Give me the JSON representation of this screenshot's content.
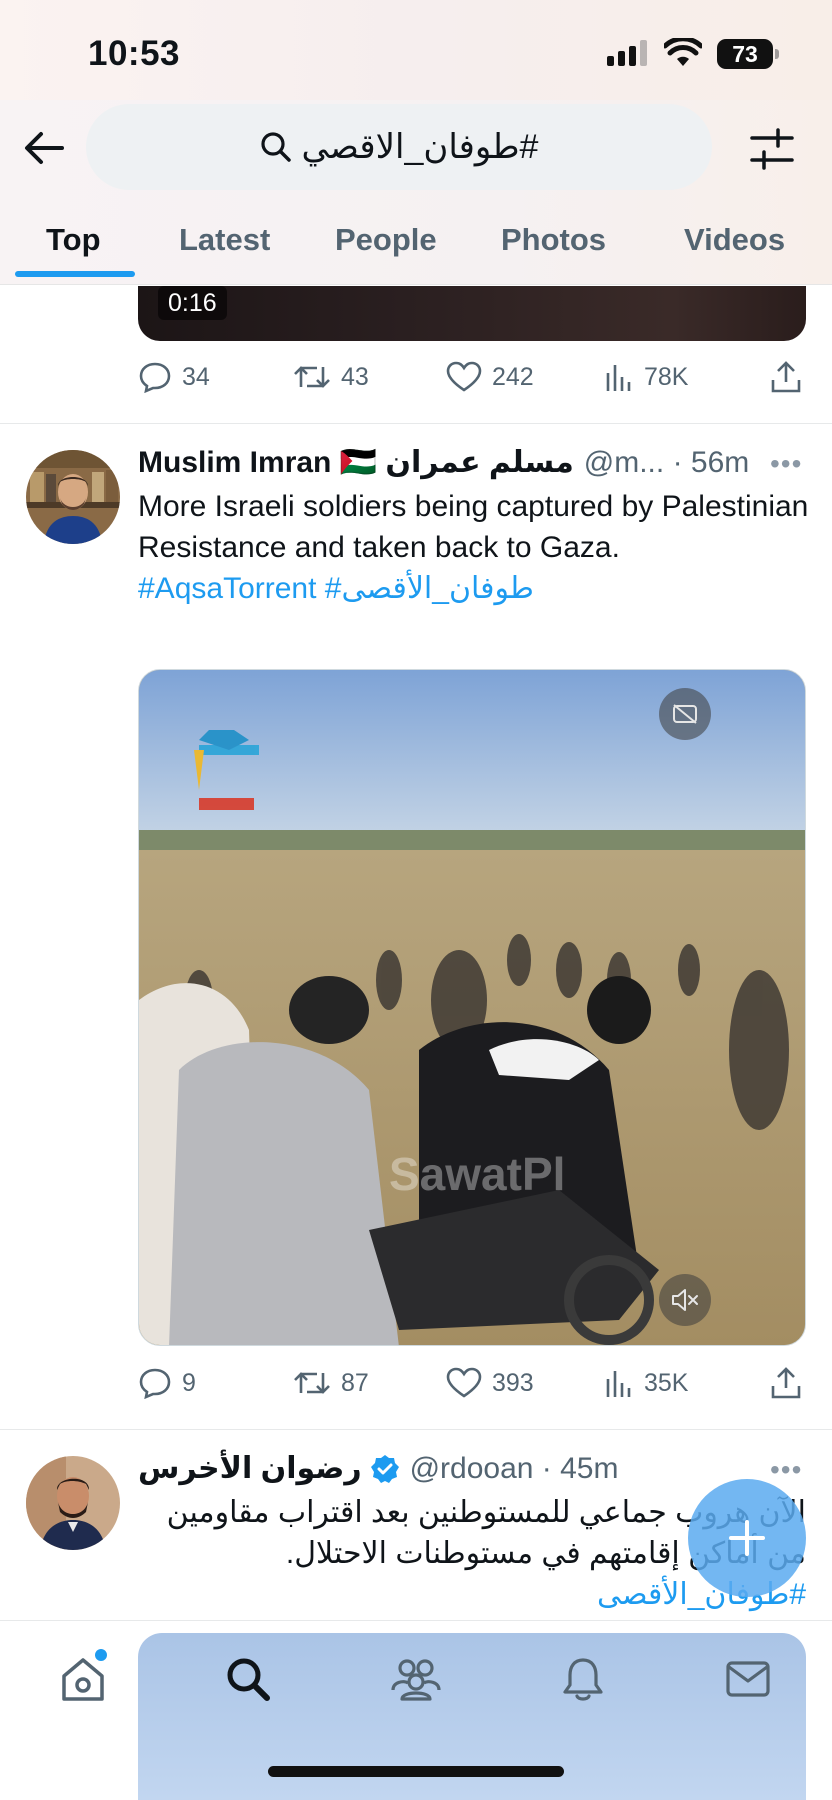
{
  "status_bar": {
    "time": "10:53",
    "battery": "73"
  },
  "search": {
    "query": "#طوفان_الاقصي"
  },
  "tabs": [
    {
      "label": "Top",
      "active": true
    },
    {
      "label": "Latest",
      "active": false
    },
    {
      "label": "People",
      "active": false
    },
    {
      "label": "Photos",
      "active": false
    },
    {
      "label": "Videos",
      "active": false
    }
  ],
  "prev_tweet": {
    "video_duration": "0:16",
    "replies": "34",
    "reposts": "43",
    "likes": "242",
    "views": "78K"
  },
  "tweet1": {
    "name": "Muslim Imran 🇵🇸 مسلم عمران",
    "handle": "@m... · 56m",
    "text": "More Israeli soldiers being captured by Palestinian Resistance and taken back to Gaza.",
    "hashtags": "#AqsaTorrent #طوفان_الأقصى",
    "media_watermark": "SawatPl",
    "replies": "9",
    "reposts": "87",
    "likes": "393",
    "views": "35K"
  },
  "tweet2": {
    "name": "رضوان الأخرس",
    "handle": "@rdooan · 45m",
    "text": "الآن هروب جماعي للمستوطنين بعد اقتراب مقاومين من أماكن إقامتهم في مستوطنات الاحتلال.",
    "hashtag": "#طوفان_الأقصى"
  },
  "colors": {
    "accent": "#1d9bf0",
    "muted": "#536471",
    "text": "#0f1419"
  },
  "icons": [
    "back-arrow-icon",
    "search-icon",
    "filter-sliders-icon",
    "reply-icon",
    "repost-icon",
    "like-icon",
    "views-icon",
    "share-icon",
    "captions-icon",
    "mute-icon",
    "more-icon",
    "verified-icon",
    "home-icon",
    "explore-icon",
    "communities-icon",
    "notifications-icon",
    "messages-icon",
    "compose-plus-icon"
  ]
}
